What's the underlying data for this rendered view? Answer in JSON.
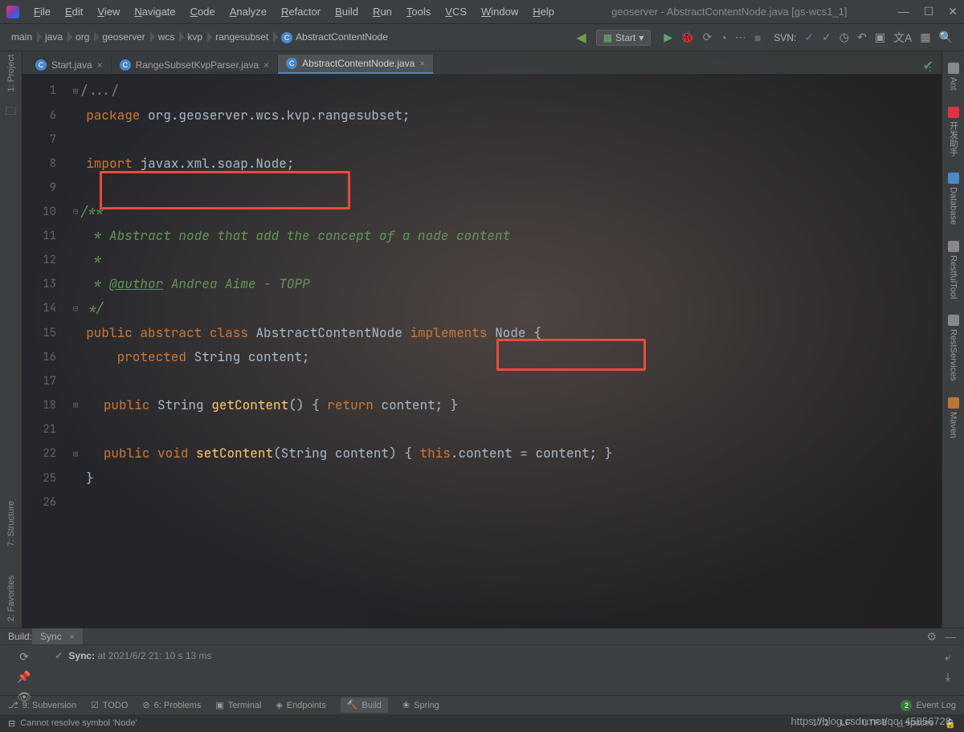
{
  "title": "geoserver - AbstractContentNode.java [gs-wcs1_1]",
  "menu": [
    "File",
    "Edit",
    "View",
    "Navigate",
    "Code",
    "Analyze",
    "Refactor",
    "Build",
    "Run",
    "Tools",
    "VCS",
    "Window",
    "Help"
  ],
  "breadcrumb": [
    "main",
    "java",
    "org",
    "geoserver",
    "wcs",
    "kvp",
    "rangesubset",
    "AbstractContentNode"
  ],
  "run_config": "Start",
  "svn_label": "SVN:",
  "tabs": [
    {
      "name": "Start.java",
      "active": false
    },
    {
      "name": "RangeSubsetKvpParser.java",
      "active": false
    },
    {
      "name": "AbstractContentNode.java",
      "active": true
    }
  ],
  "code_lines": [
    {
      "n": 1,
      "html": "<span class='fold-marker'>⊞</span><span class='com2'>/.../</span>"
    },
    {
      "n": 6,
      "html": "  <span class='kw'>package</span> <span class='pkg'>org.geoserver.wcs.kvp.rangesubset</span>;"
    },
    {
      "n": 7,
      "html": ""
    },
    {
      "n": 8,
      "html": "  <span class='kw'>import</span> <span class='pkg'>javax.xml.soap.Node</span>;"
    },
    {
      "n": 9,
      "html": ""
    },
    {
      "n": 10,
      "html": "<span class='fold-marker'>⊟</span><span class='com'>/**</span>"
    },
    {
      "n": 11,
      "html": "  <span class='com'> * Abstract node that add the concept of a node content</span>"
    },
    {
      "n": 12,
      "html": "  <span class='com'> *</span>"
    },
    {
      "n": 13,
      "html": "  <span class='com'> * <span class='ann'>@author</span> Andrea Aime - TOPP</span>"
    },
    {
      "n": 14,
      "html": "<span class='fold-marker'>⊟</span><span class='com'> */</span>"
    },
    {
      "n": 15,
      "html": "  <span class='kw'>public</span> <span class='kw'>abstract</span> <span class='kw'>class</span> AbstractContentNode <span class='kw'>implements</span> Node {"
    },
    {
      "n": 16,
      "html": "      <span class='kw'>protected</span> String content;"
    },
    {
      "n": 17,
      "html": ""
    },
    {
      "n": 18,
      "html": "<span class='fold-marker'>⊞</span>   <span class='kw'>public</span> String <span class='id'>getContent</span>() { <span class='kw'>return</span> content; }"
    },
    {
      "n": 21,
      "html": ""
    },
    {
      "n": 22,
      "html": "<span class='fold-marker'>⊞</span>   <span class='kw'>public</span> <span class='kw'>void</span> <span class='id'>setContent</span>(String content) { <span class='kw'>this</span>.content = content; }"
    },
    {
      "n": 25,
      "html": "  }"
    },
    {
      "n": 26,
      "html": ""
    }
  ],
  "build": {
    "label": "Build:",
    "tab": "Sync",
    "line": "Sync:",
    "line_tail": " at 2021/6/2 21: 10 s 13 ms"
  },
  "bottom_tools": [
    {
      "icon": "⎇",
      "label": "9: Subversion"
    },
    {
      "icon": "☑",
      "label": "TODO"
    },
    {
      "icon": "⊘",
      "label": "6: Problems"
    },
    {
      "icon": "▣",
      "label": "Terminal"
    },
    {
      "icon": "◈",
      "label": "Endpoints"
    },
    {
      "icon": "🔨",
      "label": "Build",
      "active": true
    },
    {
      "icon": "❀",
      "label": "Spring"
    }
  ],
  "event_log": {
    "count": "2",
    "label": "Event Log"
  },
  "status": {
    "error": "Cannot resolve symbol 'Node'",
    "pos": "17:1",
    "enc": "UTF-8",
    "spaces": "4 spaces"
  },
  "left_tabs": {
    "project": "1: Project",
    "structure": "7: Structure",
    "favorites": "2: Favorites"
  },
  "right_tabs": [
    "Ant",
    "开发助手",
    "Database",
    "RestfulTool",
    "RestServices",
    "Maven"
  ],
  "watermark": "https://blog.csdn.net/qq_45856728"
}
